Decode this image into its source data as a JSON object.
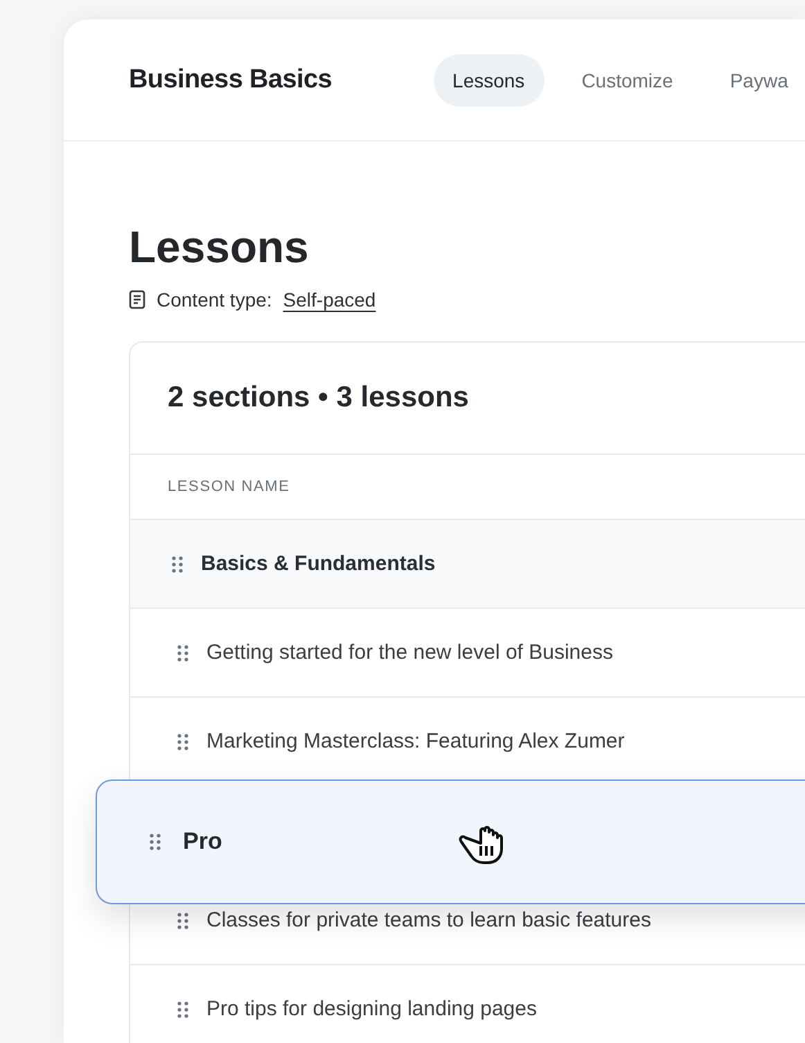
{
  "app": {
    "title": "Business Basics"
  },
  "tabs": [
    {
      "label": "Lessons",
      "selected": true
    },
    {
      "label": "Customize",
      "selected": false
    },
    {
      "label": "Paywa",
      "selected": false
    }
  ],
  "page": {
    "heading": "Lessons",
    "content_type_label": "Content type:",
    "content_type_value": "Self-paced"
  },
  "table": {
    "summary": "2 sections • 3 lessons",
    "column": "LESSON NAME",
    "sections": [
      {
        "title": "Basics & Fundamentals",
        "dragging": false,
        "lessons": [
          "Getting started for the new level of Business",
          "Marketing Masterclass: Featuring Alex Zumer"
        ]
      },
      {
        "title": "Pro",
        "dragging": true,
        "lessons": [
          "Classes for private teams to learn basic features",
          "Pro tips for designing landing pages"
        ]
      }
    ]
  }
}
